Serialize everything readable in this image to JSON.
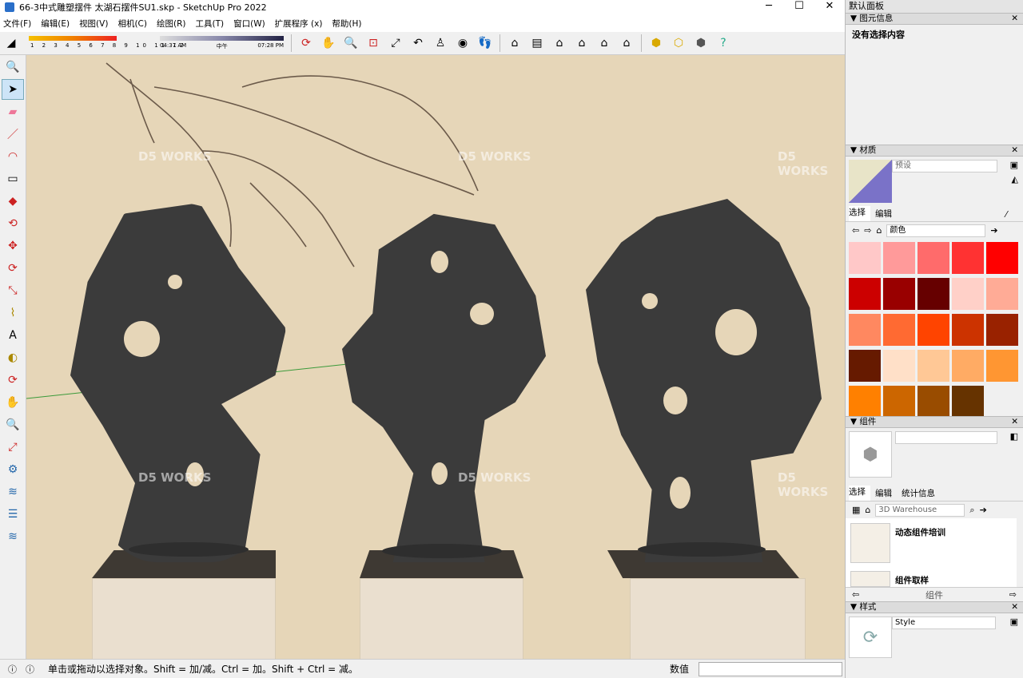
{
  "window": {
    "title": "66-3中式雕塑摆件 太湖石摆件SU1.skp - SketchUp Pro 2022",
    "minimize": "─",
    "maximize": "☐",
    "close": "✕"
  },
  "menu": [
    "文件(F)",
    "编辑(E)",
    "视图(V)",
    "相机(C)",
    "绘图(R)",
    "工具(T)",
    "窗口(W)",
    "扩展程序 (x)",
    "帮助(H)"
  ],
  "shadow": {
    "months": "1 2 3 4 5 6 7 8 9 10 11 12",
    "time_start": "04:37 AM",
    "time_mid": "中午",
    "time_end": "07:28 PM"
  },
  "status": {
    "hint": "单击或拖动以选择对象。Shift = 加/减。Ctrl = 加。Shift + Ctrl = 减。",
    "value_label": "数值"
  },
  "watermark": "D5 WORKS",
  "tray": {
    "title": "默认面板",
    "entity_info": {
      "header": "图元信息",
      "text": "没有选择内容"
    },
    "materials": {
      "header": "材质",
      "name": "预设",
      "tab_select": "选择",
      "tab_edit": "编辑",
      "library": "颜色",
      "colors": [
        "#ffc8c8",
        "#ff9a9a",
        "#ff6b6b",
        "#ff3232",
        "#ff0000",
        "#cc0000",
        "#990000",
        "#660000",
        "#ffd0c8",
        "#ffab96",
        "#ff8860",
        "#ff6a32",
        "#ff4400",
        "#cc3300",
        "#992200",
        "#661a00",
        "#ffe0c8",
        "#ffc896",
        "#ffab64",
        "#ff9632",
        "#ff8000",
        "#cc6600",
        "#994c00",
        "#663300"
      ]
    },
    "components": {
      "header": "组件",
      "tab_select": "选择",
      "tab_edit": "编辑",
      "tab_stats": "统计信息",
      "search": "3D Warehouse",
      "item1": "动态组件培训",
      "item2": "组件取样",
      "footer": "组件"
    },
    "styles": {
      "header": "样式",
      "name": "Style"
    }
  }
}
